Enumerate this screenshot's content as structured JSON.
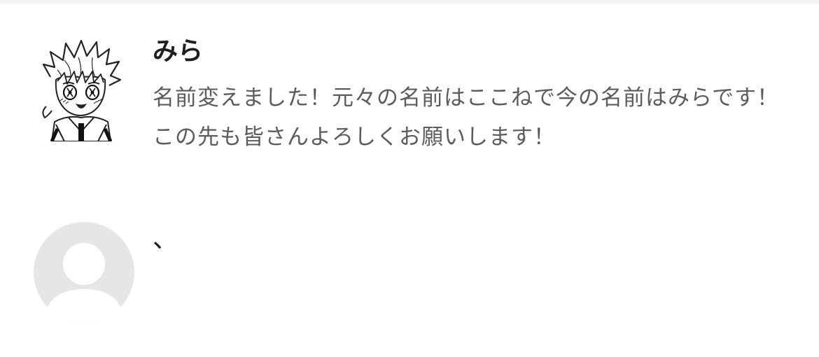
{
  "comments": [
    {
      "username": "みら",
      "avatar": "anime-character-avatar-icon",
      "text": "名前変えました！元々の名前はここねで今の名前はみらです！この先も皆さんよろしくお願いします！"
    },
    {
      "username": "",
      "avatar": "default-user-avatar-icon",
      "text": "、"
    }
  ],
  "colors": {
    "username": "#1e1e1e",
    "body_text": "#5c5c5c",
    "default_avatar_bg": "#e6e6e6",
    "default_avatar_fg": "#ffffff"
  }
}
